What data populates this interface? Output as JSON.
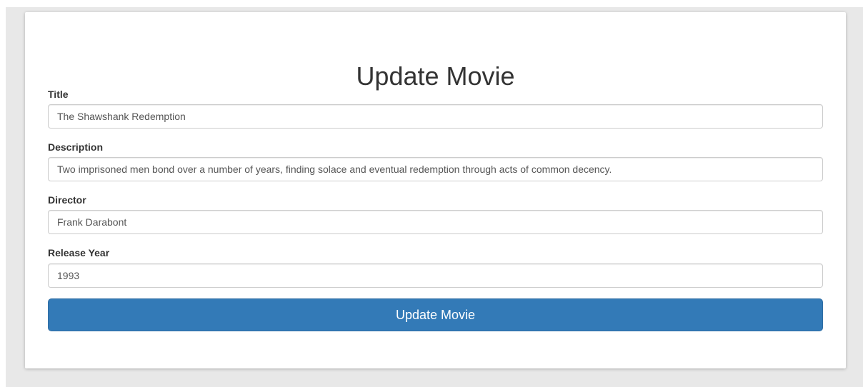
{
  "form": {
    "title": "Update Movie",
    "fields": [
      {
        "label": "Title",
        "value": "The Shawshank Redemption"
      },
      {
        "label": "Description",
        "value": "Two imprisoned men bond over a number of years, finding solace and eventual redemption through acts of common decency."
      },
      {
        "label": "Director",
        "value": "Frank Darabont"
      },
      {
        "label": "Release Year",
        "value": "1993"
      }
    ],
    "submit_label": "Update Movie"
  },
  "colors": {
    "background": "#e8e8e8",
    "card": "#ffffff",
    "primary_button": "#337ab7",
    "text": "#333333"
  }
}
